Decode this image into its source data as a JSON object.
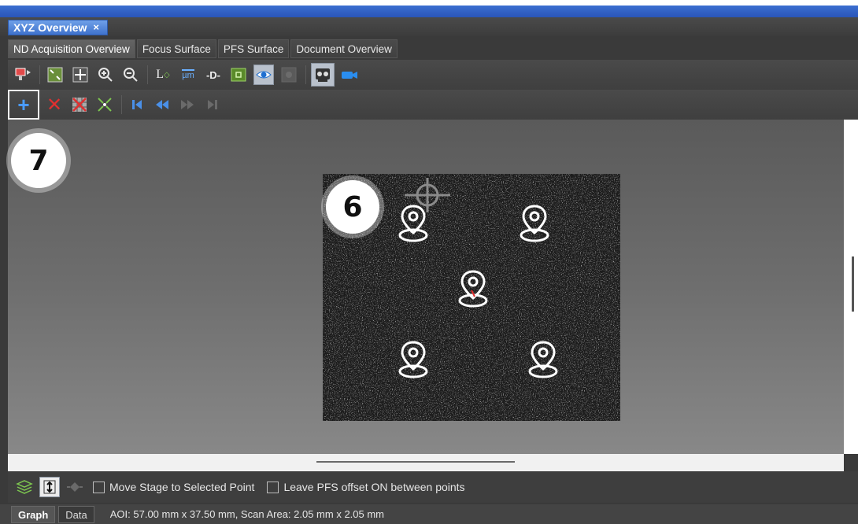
{
  "panel_tab": {
    "title": "XYZ Overview",
    "close": "×"
  },
  "sub_tabs": [
    {
      "label": "ND Acquisition Overview",
      "active": true
    },
    {
      "label": "Focus Surface",
      "active": false
    },
    {
      "label": "PFS Surface",
      "active": false
    },
    {
      "label": "Document Overview",
      "active": false
    }
  ],
  "toolbar1": {
    "icons": [
      "monitor-arrow-icon",
      "fit-selection-icon",
      "fit-all-icon",
      "zoom-in-icon",
      "zoom-out-icon",
      "axis-l-icon",
      "scale-um-icon",
      "distance-d-icon",
      "region-green-icon",
      "eye-view-icon",
      "overlay-disabled-icon",
      "camera-robot-icon",
      "camera-blue-icon"
    ],
    "labels": {
      "axis": "L",
      "scale": "µm",
      "distance": "-D-"
    }
  },
  "toolbar2": {
    "icons": [
      "add-point-icon",
      "delete-point-icon",
      "delete-all-icon",
      "grid-points-icon",
      "first-point-icon",
      "previous-point-icon",
      "next-point-icon",
      "last-point-icon"
    ],
    "add_symbol": "+",
    "delete_symbol": "✕"
  },
  "callouts": {
    "seven": "7",
    "six": "6"
  },
  "options": {
    "move_stage": "Move Stage to Selected Point",
    "leave_pfs": "Leave PFS offset ON between points"
  },
  "bottom_tabs": [
    {
      "label": "Graph",
      "active": true
    },
    {
      "label": "Data",
      "active": false
    }
  ],
  "status": "AOI: 57.00 mm x 37.50 mm, Scan Area: 2.05 mm x 2.05 mm",
  "colors": {
    "accent_blue": "#3f72cc",
    "point_marker": "#ffffff",
    "delete_red": "#e03030",
    "green_tool": "#7ec850"
  }
}
